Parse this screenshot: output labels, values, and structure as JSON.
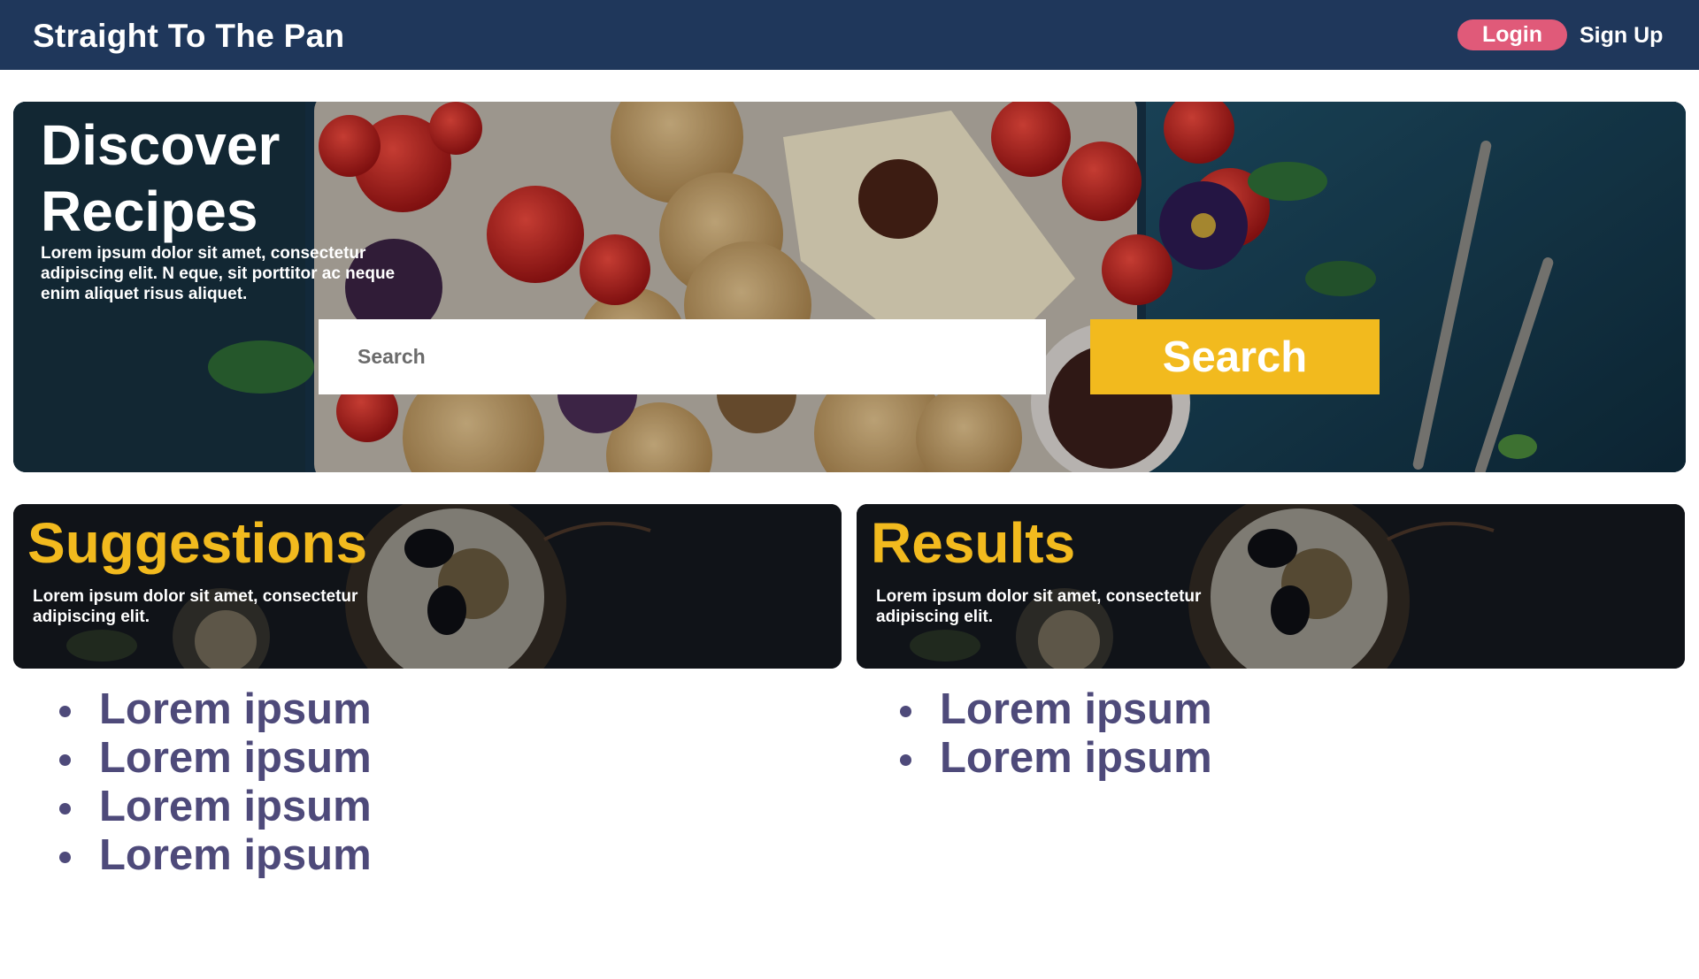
{
  "header": {
    "brand": "Straight To The Pan",
    "login_label": "Login",
    "signup_label": "Sign Up"
  },
  "hero": {
    "title": "Discover Recipes",
    "description": "Lorem ipsum dolor sit amet, consectetur adipiscing elit. N eque, sit porttitor ac neque enim aliquet risus aliquet.",
    "search_placeholder": "Search",
    "search_button": "Search"
  },
  "suggestions": {
    "title": "Suggestions",
    "description": "Lorem ipsum dolor sit amet, consectetur adipiscing elit.",
    "items": [
      "Lorem ipsum",
      "Lorem ipsum",
      "Lorem ipsum",
      "Lorem ipsum"
    ]
  },
  "results": {
    "title": "Results",
    "description": "Lorem ipsum dolor sit amet, consectetur adipiscing elit.",
    "items": [
      "Lorem ipsum",
      "Lorem ipsum"
    ]
  },
  "colors": {
    "navbar": "#1f375b",
    "login_button": "#e05a79",
    "accent_yellow": "#f2ba1e",
    "list_text": "#4e4a7a"
  }
}
